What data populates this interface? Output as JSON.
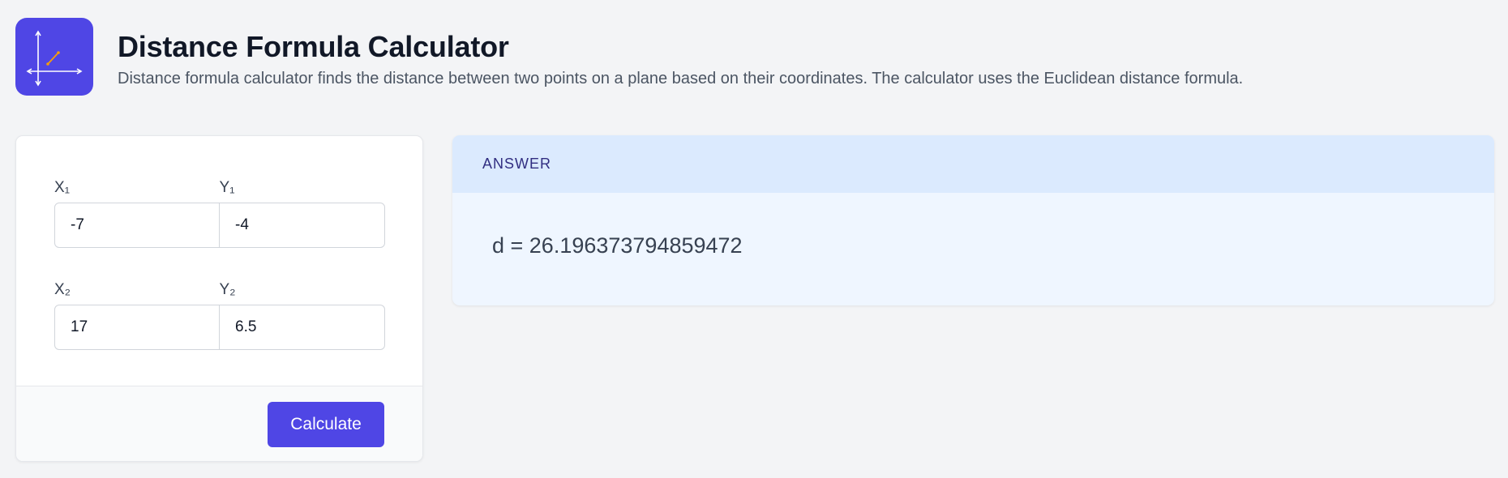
{
  "header": {
    "title": "Distance Formula Calculator",
    "description": "Distance formula calculator finds the distance between two points on a plane based on their coordinates. The calculator uses the Euclidean distance formula."
  },
  "logo": {
    "icon": "coordinate-plane-icon",
    "accent": "#4f46e5"
  },
  "inputs": {
    "x1_label": "X₁",
    "y1_label": "Y₁",
    "x2_label": "X₂",
    "y2_label": "Y₂",
    "x1_value": "-7",
    "y1_value": "-4",
    "x2_value": "17",
    "y2_value": "6.5"
  },
  "actions": {
    "calculate_label": "Calculate"
  },
  "answer": {
    "heading": "ANSWER",
    "result": "d = 26.196373794859472"
  },
  "colors": {
    "accent": "#4f46e5",
    "answer_header_bg": "#dbeafe",
    "answer_body_bg": "#eff6ff",
    "page_bg": "#f3f4f6"
  }
}
